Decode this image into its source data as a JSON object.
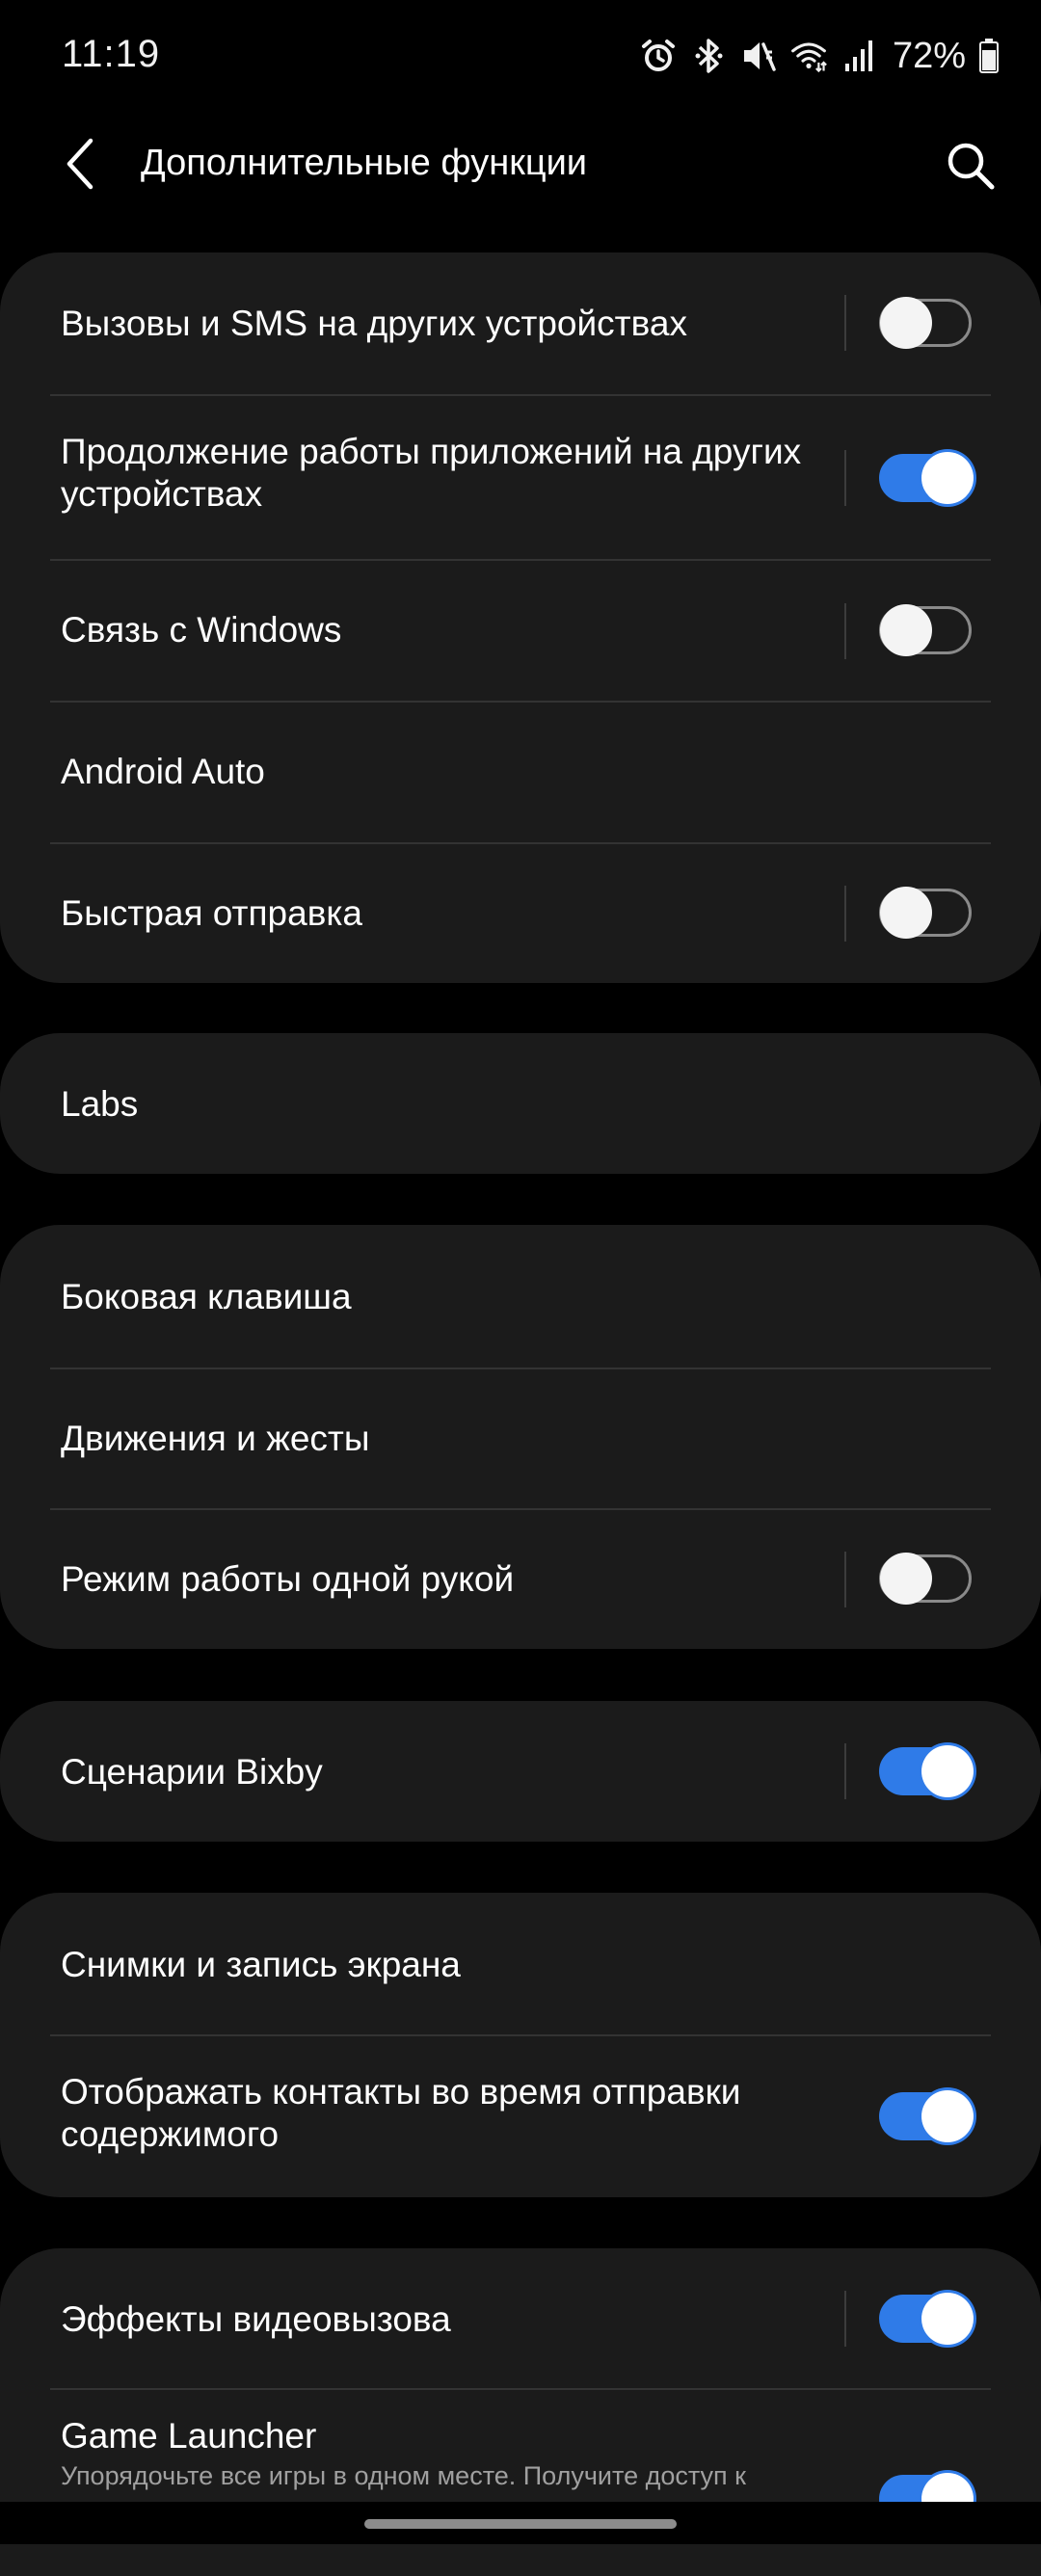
{
  "status_bar": {
    "time": "11:19",
    "battery_percent": "72%",
    "icons": [
      "alarm-icon",
      "bluetooth-icon",
      "mute-icon",
      "wifi-icon",
      "signal-icon",
      "battery-icon"
    ]
  },
  "header": {
    "title": "Дополнительные функции",
    "back_icon": "chevron-left-icon",
    "search_icon": "search-icon"
  },
  "groups": [
    {
      "items": [
        {
          "label": "Вызовы и SMS на других устройствах",
          "toggle": "off"
        },
        {
          "label": "Продолжение работы приложений на других устройствах",
          "toggle": "on"
        },
        {
          "label": "Связь с Windows",
          "toggle": "off"
        },
        {
          "label": "Android Auto",
          "toggle": "none"
        },
        {
          "label": "Быстрая отправка",
          "toggle": "off"
        }
      ]
    },
    {
      "items": [
        {
          "label": "Labs",
          "toggle": "none"
        }
      ]
    },
    {
      "items": [
        {
          "label": "Боковая клавиша",
          "toggle": "none"
        },
        {
          "label": "Движения и жесты",
          "toggle": "none"
        },
        {
          "label": "Режим работы одной рукой",
          "toggle": "off"
        }
      ]
    },
    {
      "items": [
        {
          "label": "Сценарии Bixby",
          "toggle": "on"
        }
      ]
    },
    {
      "items": [
        {
          "label": "Снимки и запись экрана",
          "toggle": "none"
        },
        {
          "label": "Отображать контакты во время отправки содержимого",
          "toggle": "on"
        }
      ]
    },
    {
      "items": [
        {
          "label": "Эффекты видеовызова",
          "toggle": "on"
        },
        {
          "label": "Game Launcher",
          "subtitle": "Упорядочьте все игры в одном месте. Получите доступ к",
          "toggle": "on"
        }
      ]
    }
  ],
  "colors": {
    "background": "#000000",
    "card": "#1b1b1b",
    "accent": "#2f7be8",
    "divider": "#333333"
  }
}
